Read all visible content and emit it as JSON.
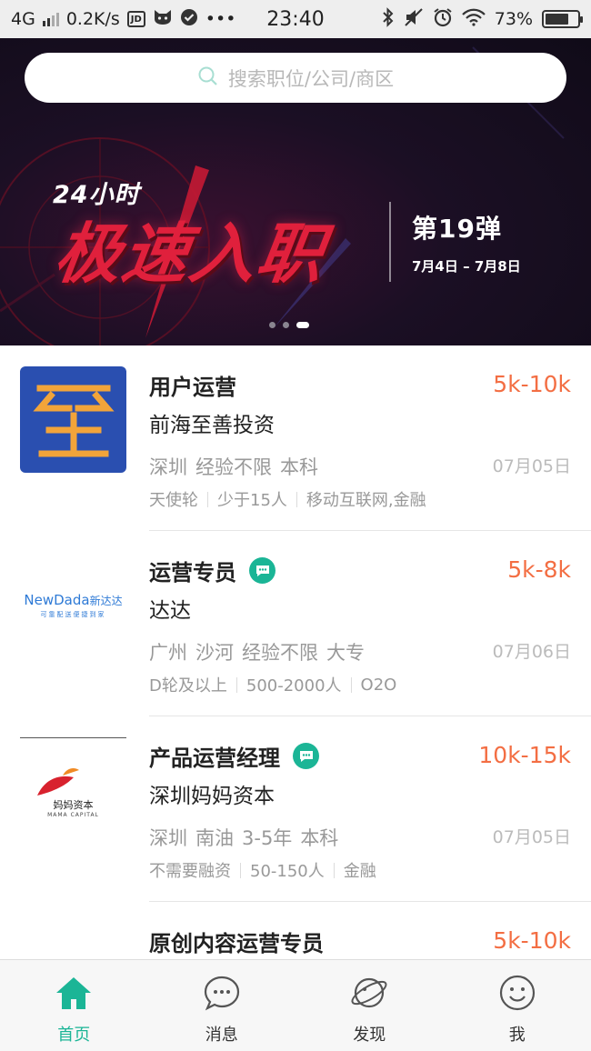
{
  "status_bar": {
    "network": "4G",
    "speed": "0.2K/s",
    "app_badge": "JD",
    "more": "•••",
    "time": "23:40",
    "battery_text": "73%",
    "battery_level": 0.73
  },
  "search": {
    "placeholder": "搜索职位/公司/商区"
  },
  "banner": {
    "tag": "24小时",
    "title": "极速入职",
    "issue": "第19弹",
    "dates": "7月4日 – 7月8日",
    "page_count": 3,
    "active_page": 3
  },
  "jobs": [
    {
      "title": "用户运营",
      "salary": "5k-10k",
      "company": "前海至善投资",
      "city": "深圳",
      "experience": "经验不限",
      "education": "本科",
      "date": "07月05日",
      "funding": "天使轮",
      "size": "少于15人",
      "industry": "移动互联网,金融",
      "logo": "zhishan-logo"
    },
    {
      "title": "运营专员",
      "salary": "5k-8k",
      "company": "达达",
      "city": "广州",
      "district": "沙河",
      "experience": "经验不限",
      "education": "大专",
      "date": "07月06日",
      "funding": "D轮及以上",
      "size": "500-2000人",
      "industry": "O2O",
      "logo": "newdada-logo",
      "logo_text": "NewDada",
      "logo_cn": "新达达",
      "logo_sub": "可靠配送便捷到家"
    },
    {
      "title": "产品运营经理",
      "salary": "10k-15k",
      "company": "深圳妈妈资本",
      "city": "深圳",
      "district": "南油",
      "experience": "3-5年",
      "education": "本科",
      "date": "07月05日",
      "funding": "不需要融资",
      "size": "50-150人",
      "industry": "金融",
      "logo": "mama-capital-logo",
      "logo_cn": "妈妈资本",
      "logo_sub": "MAMA CAPITAL"
    },
    {
      "title": "原创内容运营专员",
      "salary": "5k-10k"
    }
  ],
  "tabbar": {
    "home": "首页",
    "messages": "消息",
    "discover": "发现",
    "me": "我"
  },
  "colors": {
    "accent": "#1bb596",
    "salary": "#f36e43",
    "banner_red": "#e0203c"
  }
}
